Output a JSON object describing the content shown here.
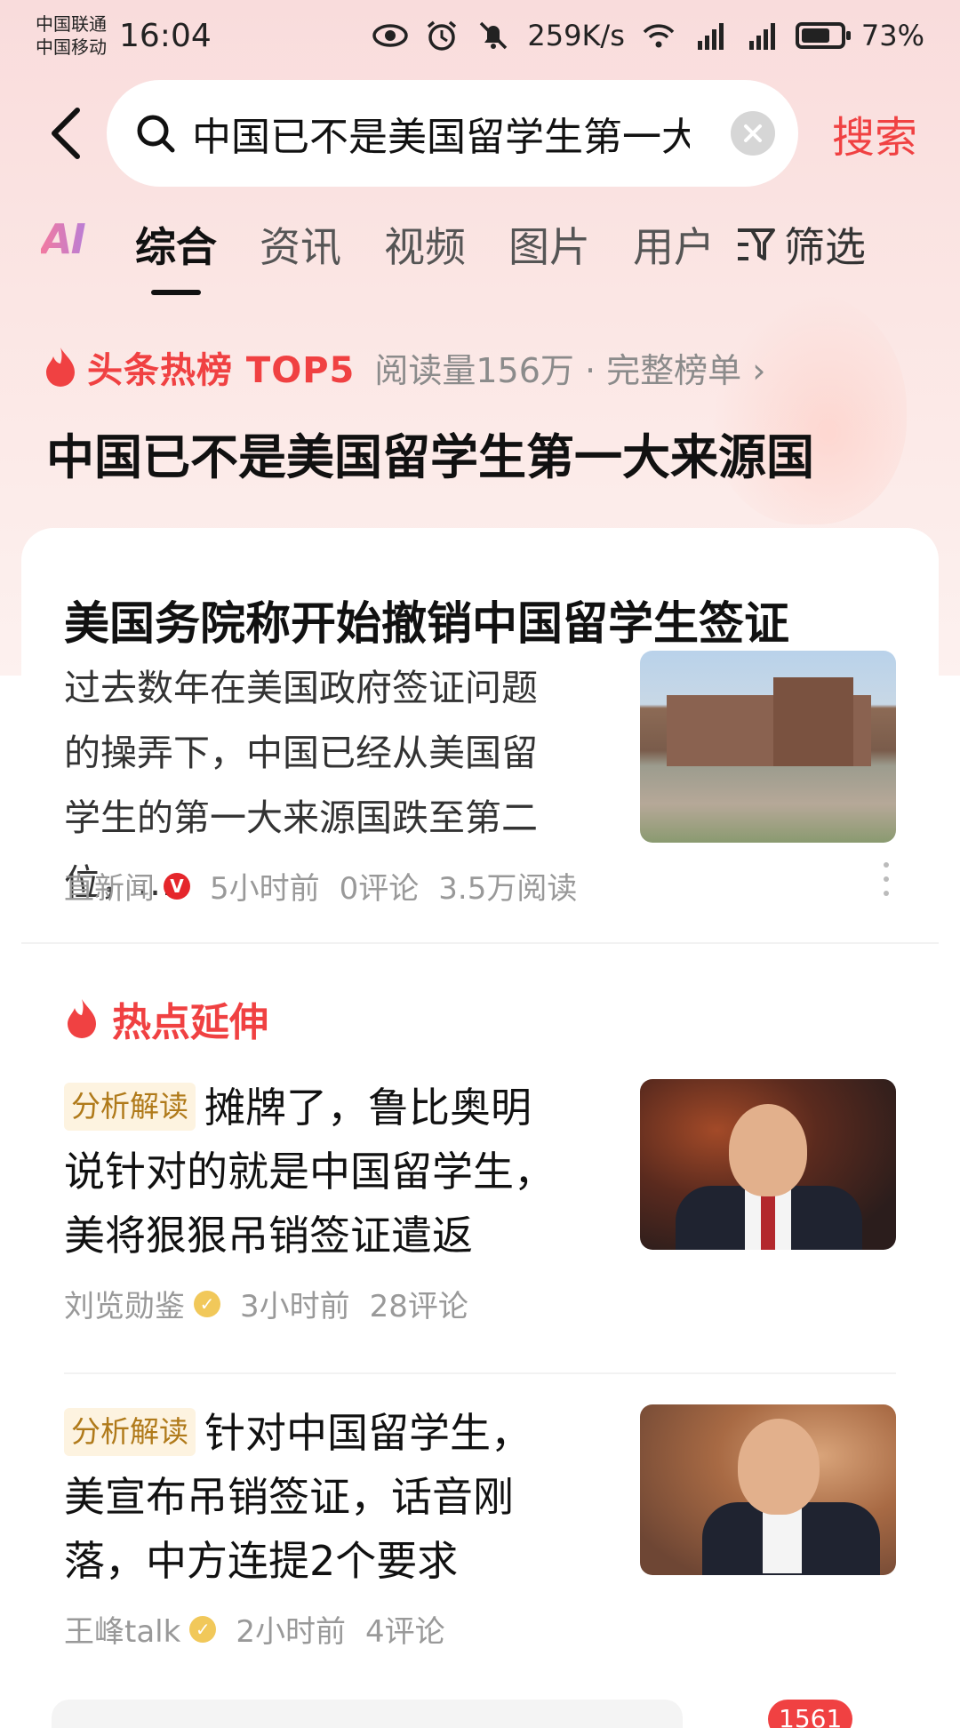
{
  "status_bar": {
    "carrier1": "中国联通",
    "carrier2": "中国移动",
    "time": "16:04",
    "speed": "259K/s",
    "battery": "73%",
    "battery_level": 0.73
  },
  "search": {
    "query": "中国已不是美国留学生第一大来源国",
    "button_label": "搜索"
  },
  "tabs": {
    "ai_label": "AI",
    "items": [
      "综合",
      "资讯",
      "视频",
      "图片",
      "用户"
    ],
    "active": "综合",
    "filter_label": "筛选"
  },
  "hot_list": {
    "label": "头条热榜 TOP5",
    "meta": "阅读量156万 · 完整榜单 ›",
    "title": "中国已不是美国留学生第一大来源国"
  },
  "main_article": {
    "title": "美国务院称开始撤销中国留学生签证",
    "summary": "过去数年在美国政府签证问题的操弄下，中国已经从美国留学生的第一大来源国跌至第二位，…",
    "source": "直新闻",
    "time": "5小时前",
    "comments": "0评论",
    "reads": "3.5万阅读"
  },
  "extension": {
    "label": "热点延伸",
    "items": [
      {
        "tag": "分析解读",
        "title": "摊牌了，鲁比奥明说针对的就是中国留学生，美将狠狠吊销签证遣返",
        "source": "刘览勋鉴",
        "time": "3小时前",
        "comments": "28评论"
      },
      {
        "tag": "分析解读",
        "title": "针对中国留学生，美宣布吊销签证，话音刚落，中方连提2个要求",
        "source": "王峰talk",
        "time": "2小时前",
        "comments": "4评论"
      }
    ]
  },
  "bottom": {
    "comment_count": "1561"
  },
  "colors": {
    "accent": "#f04142",
    "tag_bg": "#fdf3e0",
    "tag_text": "#b07a1a"
  },
  "icons": [
    "back-arrow-icon",
    "search-icon",
    "clear-icon",
    "filter-icon",
    "fire-icon",
    "verified-icon",
    "more-icon",
    "eye-icon",
    "alarm-icon",
    "mute-icon",
    "wifi-icon",
    "signal-icon",
    "battery-icon"
  ]
}
